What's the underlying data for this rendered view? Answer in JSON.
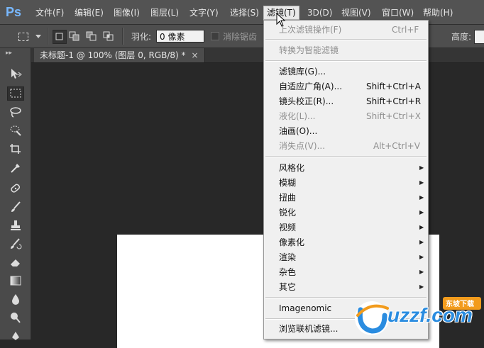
{
  "app": {
    "logo": "Ps"
  },
  "menubar": {
    "items": [
      {
        "label": "文件(F)"
      },
      {
        "label": "编辑(E)"
      },
      {
        "label": "图像(I)"
      },
      {
        "label": "图层(L)"
      },
      {
        "label": "文字(Y)"
      },
      {
        "label": "选择(S)"
      },
      {
        "label": "滤镜(T)"
      },
      {
        "label": "3D(D)"
      },
      {
        "label": "视图(V)"
      },
      {
        "label": "窗口(W)"
      },
      {
        "label": "帮助(H)"
      }
    ],
    "active": "滤镜(T)"
  },
  "options": {
    "feather_label": "羽化:",
    "feather_value": "0 像素",
    "antialias_label": "消除锯齿",
    "height_label": "高度:"
  },
  "document": {
    "tab_title": "未标题-1 @ 100% (图层 0, RGB/8) *",
    "close_glyph": "×"
  },
  "filter_menu": {
    "last_filter": {
      "label": "上次滤镜操作(F)",
      "shortcut": "Ctrl+F"
    },
    "convert_smart": {
      "label": "转换为智能滤镜"
    },
    "gallery": {
      "label": "滤镜库(G)..."
    },
    "adaptive_wide": {
      "label": "自适应广角(A)...",
      "shortcut": "Shift+Ctrl+A"
    },
    "lens_correction": {
      "label": "镜头校正(R)...",
      "shortcut": "Shift+Ctrl+R"
    },
    "liquify": {
      "label": "液化(L)...",
      "shortcut": "Shift+Ctrl+X"
    },
    "oil_paint": {
      "label": "油画(O)..."
    },
    "vanishing_point": {
      "label": "消失点(V)...",
      "shortcut": "Alt+Ctrl+V"
    },
    "submenus": [
      {
        "label": "风格化"
      },
      {
        "label": "模糊"
      },
      {
        "label": "扭曲"
      },
      {
        "label": "锐化"
      },
      {
        "label": "视频"
      },
      {
        "label": "像素化"
      },
      {
        "label": "渲染"
      },
      {
        "label": "杂色"
      },
      {
        "label": "其它"
      }
    ],
    "imagenomic": {
      "label": "Imagenomic"
    },
    "browse_online": {
      "label": "浏览联机滤镜..."
    }
  },
  "watermark": {
    "text": "uzzf.com",
    "badge": "东坡下载"
  },
  "colors": {
    "menubar_bg": "#535353",
    "dropdown_bg": "#f0f0f0",
    "accent_blue": "#2a8ce0"
  }
}
